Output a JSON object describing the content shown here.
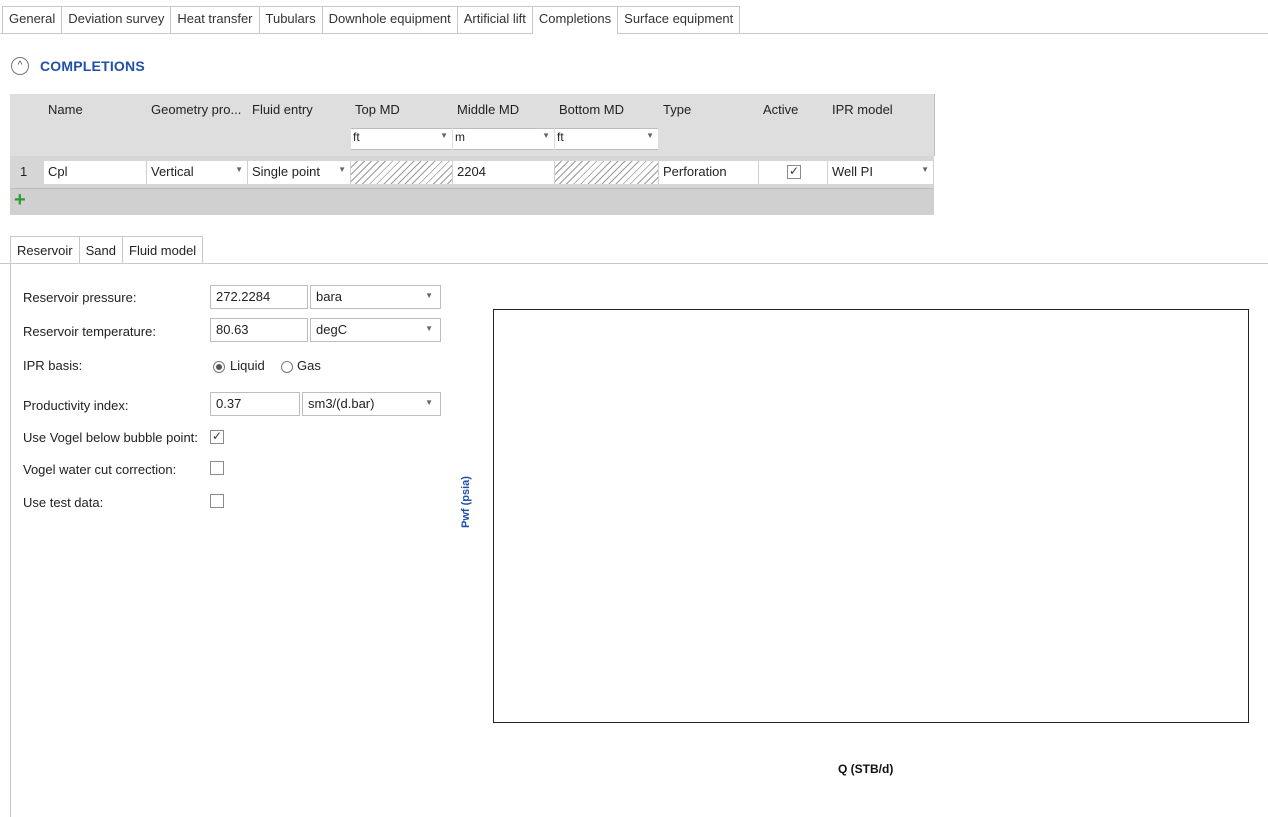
{
  "top_tabs": [
    "General",
    "Deviation survey",
    "Heat transfer",
    "Tubulars",
    "Downhole equipment",
    "Artificial lift",
    "Completions",
    "Surface equipment"
  ],
  "active_tab": "Completions",
  "section": {
    "title": "COMPLETIONS",
    "collapse_icon": "chevron-up-icon"
  },
  "grid": {
    "headers": {
      "name": "Name",
      "geometry": "Geometry pro...",
      "fluid_entry": "Fluid entry",
      "top_md": "Top MD",
      "middle_md": "Middle MD",
      "bottom_md": "Bottom MD",
      "type": "Type",
      "active": "Active",
      "ipr_model": "IPR model"
    },
    "units": {
      "top_md": "ft",
      "middle_md": "m",
      "bottom_md": "ft"
    },
    "rows": [
      {
        "num": "1",
        "name": "Cpl",
        "geometry": "Vertical",
        "fluid_entry": "Single point",
        "middle_md": "2204",
        "type": "Perforation",
        "active_mark": "✓",
        "ipr_model": "Well PI"
      }
    ],
    "add_icon": "plus-icon"
  },
  "sub_tabs": [
    "Reservoir",
    "Sand",
    "Fluid model"
  ],
  "active_sub_tab": "Reservoir",
  "form": {
    "reservoir_pressure": {
      "label": "Reservoir pressure:",
      "value": "272.2284",
      "unit": "bara"
    },
    "reservoir_temperature": {
      "label": "Reservoir temperature:",
      "value": "80.63",
      "unit": "degC"
    },
    "ipr_basis": {
      "label": "IPR basis:",
      "option_liquid": "Liquid",
      "option_gas": "Gas",
      "selected": "Liquid"
    },
    "productivity_index": {
      "label": "Productivity index:",
      "value": "0.37",
      "unit": "sm3/(d.bar)"
    },
    "use_vogel": {
      "label": "Use Vogel below bubble point:",
      "mark": "✓"
    },
    "vogel_water_cut": {
      "label": "Vogel water cut correction:",
      "mark": ""
    },
    "use_test_data": {
      "label": "Use test data:",
      "mark": ""
    }
  },
  "chart": {
    "ylabel": "Pwf (psia)",
    "xlabel": "Q (STB/d)"
  },
  "colors": {
    "accent": "#2050a8",
    "add": "#2f9b2f"
  }
}
